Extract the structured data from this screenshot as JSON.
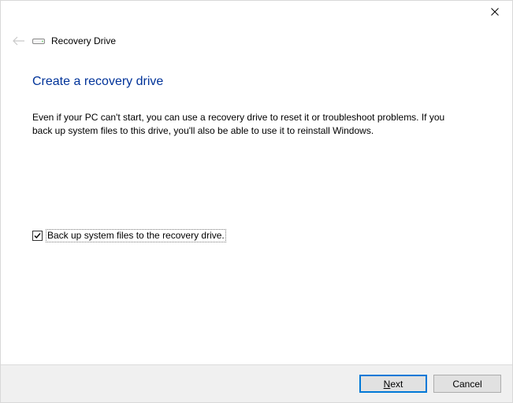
{
  "window": {
    "header_title": "Recovery Drive"
  },
  "page": {
    "title": "Create a recovery drive",
    "description": "Even if your PC can't start, you can use a recovery drive to reset it or troubleshoot problems. If you back up system files to this drive, you'll also be able to use it to reinstall Windows."
  },
  "checkbox": {
    "checked": true,
    "label": "Back up system files to the recovery drive."
  },
  "buttons": {
    "next_prefix": "N",
    "next_rest": "ext",
    "cancel": "Cancel"
  }
}
